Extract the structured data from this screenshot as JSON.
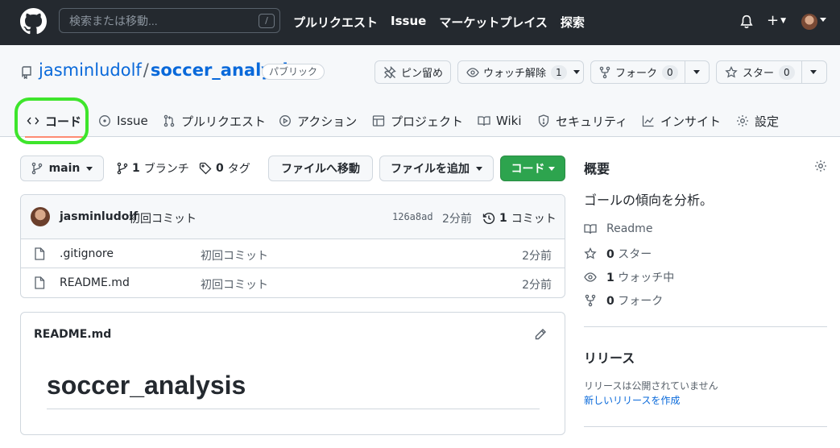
{
  "header": {
    "search_placeholder": "検索または移動...",
    "slash_key": "/",
    "nav": [
      "プルリクエスト",
      "Issue",
      "マーケットプレイス",
      "探索"
    ],
    "plus_label": "+"
  },
  "repo": {
    "owner": "jasminludolf",
    "separator": "/",
    "name": "soccer_analysis",
    "visibility": "パブリック"
  },
  "actions": {
    "pin": "ピン留め",
    "watch": "ウォッチ解除",
    "watch_count": "1",
    "fork": "フォーク",
    "fork_count": "0",
    "star": "スター",
    "star_count": "0"
  },
  "tabs": [
    "コード",
    "Issue",
    "プルリクエスト",
    "アクション",
    "プロジェクト",
    "Wiki",
    "セキュリティ",
    "インサイト",
    "設定"
  ],
  "branch_bar": {
    "branch": "main",
    "branches_count": "1",
    "branches_label": "ブランチ",
    "tags_count": "0",
    "tags_label": "タグ",
    "goto_file": "ファイルへ移動",
    "add_file": "ファイルを追加",
    "code": "コード"
  },
  "commit": {
    "user": "jasminludolf",
    "message": "初回コミット",
    "sha": "126a8ad",
    "time": "2分前",
    "count": "1",
    "count_label": "コミット"
  },
  "files": [
    {
      "name": ".gitignore",
      "message": "初回コミット",
      "time": "2分前"
    },
    {
      "name": "README.md",
      "message": "初回コミット",
      "time": "2分前"
    }
  ],
  "readme": {
    "label": "README.md",
    "heading": "soccer_analysis"
  },
  "sidebar": {
    "about_title": "概要",
    "description": "ゴールの傾向を分析。",
    "readme": "Readme",
    "stars_count": "0",
    "stars_label": "スター",
    "watching_count": "1",
    "watching_label": "ウォッチ中",
    "forks_count": "0",
    "forks_label": "フォーク",
    "releases_title": "リリース",
    "releases_none": "リリースは公開されていません",
    "new_release": "新しいリリースを作成"
  }
}
